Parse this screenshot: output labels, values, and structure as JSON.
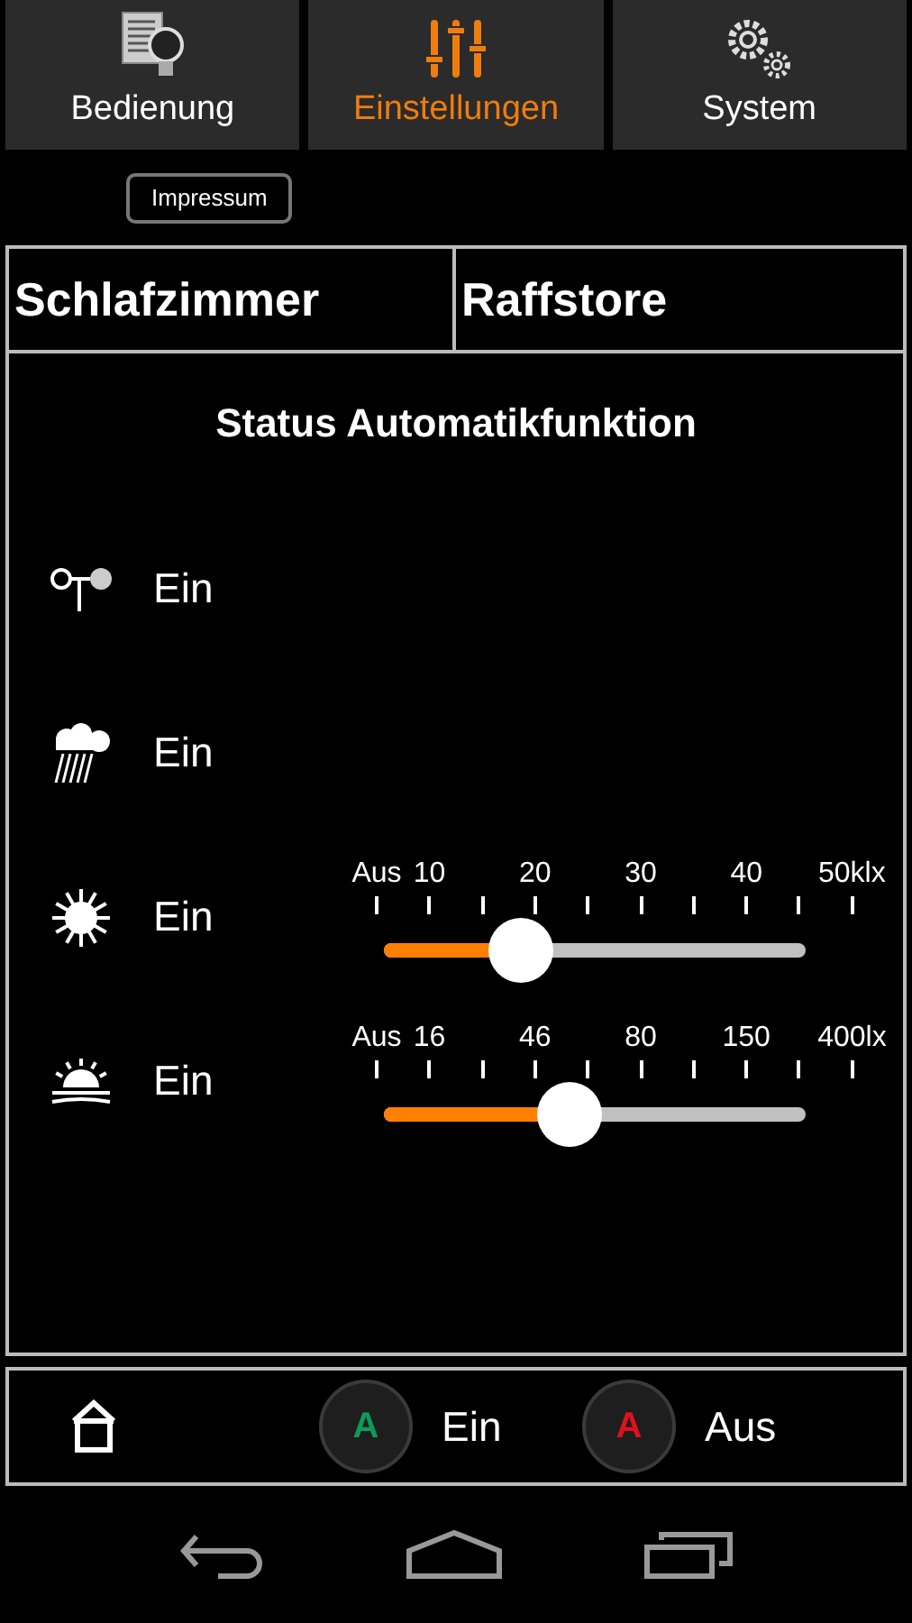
{
  "tabs": [
    {
      "label": "Bedienung",
      "kind": "bulb",
      "selected": false
    },
    {
      "label": "Einstellungen",
      "kind": "sliders",
      "selected": true
    },
    {
      "label": "System",
      "kind": "gears",
      "selected": false
    }
  ],
  "impressum_button": "Impressum",
  "header": {
    "room": "Schlafzimmer",
    "device": "Raffstore"
  },
  "title": "Status Automatikfunktion",
  "rows": [
    {
      "kind": "wind",
      "state": "Ein"
    },
    {
      "kind": "rain",
      "state": "Ein"
    },
    {
      "kind": "sun",
      "state": "Ein",
      "scale": [
        "Aus",
        "10",
        "20",
        "30",
        "40",
        "50klx"
      ],
      "level": 0.325
    },
    {
      "kind": "dusk",
      "state": "Ein",
      "scale": [
        "Aus",
        "16",
        "46",
        "80",
        "150",
        "400lx"
      ],
      "level": 0.44
    }
  ],
  "footer": {
    "buttons": [
      {
        "letter": "A",
        "color": "#0f9a5a",
        "label": "Ein"
      },
      {
        "letter": "A",
        "color": "#e0101e",
        "label": "Aus"
      }
    ]
  }
}
